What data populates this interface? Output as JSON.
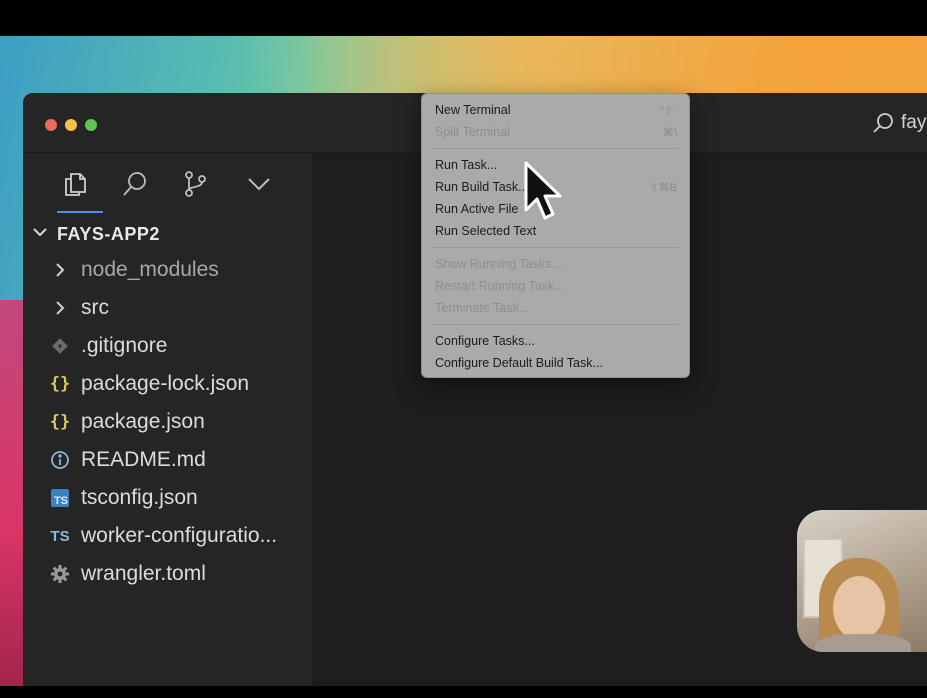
{
  "titlebar": {
    "search_text": "fay"
  },
  "explorer": {
    "project_name": "FAYS-APP2",
    "items": [
      {
        "label": "node_modules",
        "icon": "chevron-right-icon",
        "dim": true
      },
      {
        "label": "src",
        "icon": "chevron-right-icon",
        "dim": false
      },
      {
        "label": ".gitignore",
        "icon": "git-file-icon",
        "dim": false
      },
      {
        "label": "package-lock.json",
        "icon": "json-braces-icon",
        "dim": false
      },
      {
        "label": "package.json",
        "icon": "json-braces-icon",
        "dim": false
      },
      {
        "label": "README.md",
        "icon": "info-icon",
        "dim": false
      },
      {
        "label": "tsconfig.json",
        "icon": "ts-config-icon",
        "dim": false
      },
      {
        "label": "worker-configuratio...",
        "icon": "ts-icon",
        "dim": false
      },
      {
        "label": "wrangler.toml",
        "icon": "gear-icon",
        "dim": false
      }
    ],
    "json_glyph": "{}",
    "ts_glyph": "TS",
    "ts_box_glyph": "TS"
  },
  "menu": {
    "items": [
      {
        "label": "New Terminal",
        "shortcut": "^⇧`",
        "disabled": false
      },
      {
        "label": "Split Terminal",
        "shortcut": "⌘\\",
        "disabled": true
      },
      {
        "sep": true
      },
      {
        "label": "Run Task...",
        "shortcut": "",
        "disabled": false
      },
      {
        "label": "Run Build Task...",
        "shortcut": "⇧⌘B",
        "disabled": false
      },
      {
        "label": "Run Active File",
        "shortcut": "",
        "disabled": false
      },
      {
        "label": "Run Selected Text",
        "shortcut": "",
        "disabled": false
      },
      {
        "sep": true
      },
      {
        "label": "Show Running Tasks...",
        "shortcut": "",
        "disabled": true
      },
      {
        "label": "Restart Running Task...",
        "shortcut": "",
        "disabled": true
      },
      {
        "label": "Terminate Task...",
        "shortcut": "",
        "disabled": true
      },
      {
        "sep": true
      },
      {
        "label": "Configure Tasks...",
        "shortcut": "",
        "disabled": false
      },
      {
        "label": "Configure Default Build Task...",
        "shortcut": "",
        "disabled": false
      }
    ]
  },
  "colors": {
    "editor_bg": "#1e1e1e",
    "sidebar_bg": "#252526",
    "accent": "#4a8ff0",
    "json_icon": "#d6c75e",
    "ts_icon": "#3b7fc4"
  }
}
